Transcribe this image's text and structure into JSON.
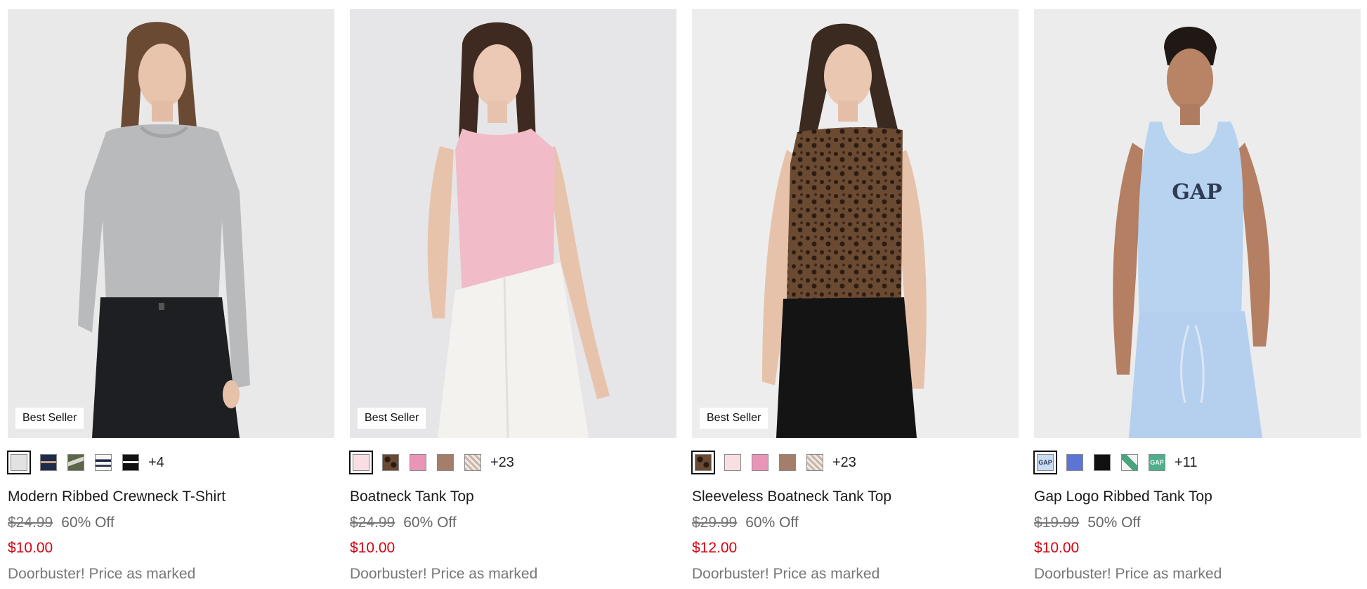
{
  "colors": {
    "sale_price": "#d9000d",
    "original_price": "#777777",
    "promo_text": "#777777",
    "photo_background": "#e8e8e8"
  },
  "products": [
    {
      "badge": "Best Seller",
      "name": "Modern Ribbed Crewneck T-Shirt",
      "original_price": "$24.99",
      "discount": "60% Off",
      "sale_price": "$10.00",
      "promo": "Doorbuster! Price as marked",
      "more_colors": "+4",
      "swatches": [
        "light-grey",
        "navy-stripe",
        "olive-stripe",
        "white-navy-stripe",
        "black-white-stripe"
      ],
      "model": {
        "top": "grey long-sleeve ribbed tee",
        "bottom": "black jeans"
      }
    },
    {
      "badge": "Best Seller",
      "name": "Boatneck Tank Top",
      "original_price": "$24.99",
      "discount": "60% Off",
      "sale_price": "$10.00",
      "promo": "Doorbuster! Price as marked",
      "more_colors": "+23",
      "swatches": [
        "light-pink",
        "leopard",
        "pink",
        "brown",
        "houndstooth"
      ],
      "model": {
        "top": "light pink tank",
        "bottom": "white trousers"
      }
    },
    {
      "badge": "Best Seller",
      "name": "Sleeveless Boatneck Tank Top",
      "original_price": "$29.99",
      "discount": "60% Off",
      "sale_price": "$12.00",
      "promo": "Doorbuster! Price as marked",
      "more_colors": "+23",
      "swatches": [
        "leopard",
        "light-pink",
        "pink",
        "brown",
        "houndstooth"
      ],
      "model": {
        "top": "leopard print tank",
        "bottom": "black pants"
      }
    },
    {
      "badge": "",
      "name": "Gap Logo Ribbed Tank Top",
      "original_price": "$19.99",
      "discount": "50% Off",
      "sale_price": "$10.00",
      "promo": "Doorbuster! Price as marked",
      "more_colors": "+11",
      "swatches": [
        "light-blue-logo",
        "royal-blue",
        "black",
        "white-green-logo",
        "green-logo"
      ],
      "logo_text": "GAP",
      "model": {
        "top": "light blue logo tank",
        "bottom": "light blue sweatpants"
      }
    }
  ]
}
